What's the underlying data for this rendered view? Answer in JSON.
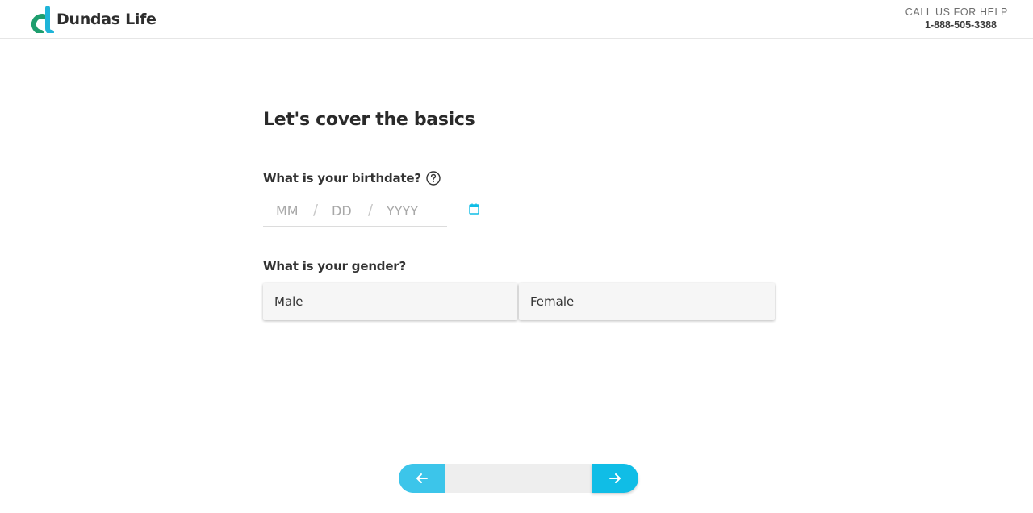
{
  "header": {
    "brand": "Dundas Life",
    "help_label": "CALL US FOR HELP",
    "help_phone": "1-888-505-3388"
  },
  "main": {
    "title": "Let's cover the basics",
    "birthdate": {
      "question": "What is your birthdate?",
      "month_placeholder": "MM",
      "day_placeholder": "DD",
      "year_placeholder": "YYYY",
      "separator": "/"
    },
    "gender": {
      "question": "What is your gender?",
      "options": [
        "Male",
        "Female"
      ]
    }
  },
  "colors": {
    "accent": "#10bde6",
    "accent_light": "#3cc5ea",
    "logo_green": "#1e9e6e",
    "logo_teal": "#1fb4d8"
  },
  "icons": {
    "help": "question-circle-icon",
    "calendar": "calendar-icon",
    "back": "arrow-left-icon",
    "next": "arrow-right-icon"
  }
}
